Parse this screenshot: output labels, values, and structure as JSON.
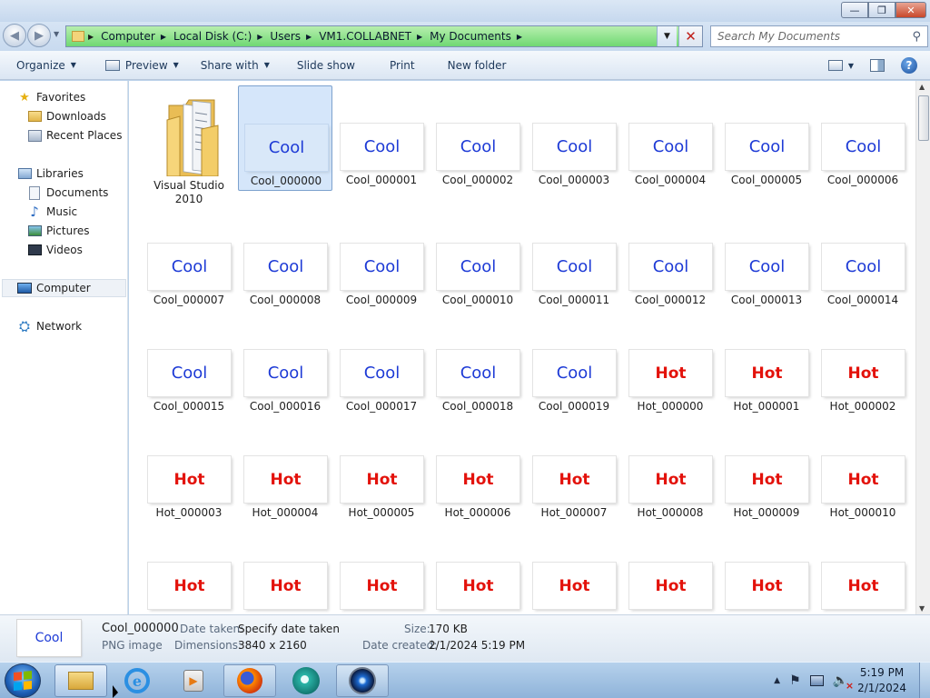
{
  "window": {
    "controls": {
      "minimize": "—",
      "maximize": "❐",
      "close": "✕"
    }
  },
  "address": {
    "breadcrumbs": [
      "Computer",
      "Local Disk (C:)",
      "Users",
      "VM1.COLLABNET",
      "My Documents"
    ],
    "search_placeholder": "Search My Documents"
  },
  "toolbar": {
    "organize": "Organize",
    "preview": "Preview",
    "share_with": "Share with",
    "slide_show": "Slide show",
    "print": "Print",
    "new_folder": "New folder"
  },
  "nav": {
    "favorites": "Favorites",
    "downloads": "Downloads",
    "recent_places": "Recent Places",
    "libraries": "Libraries",
    "documents": "Documents",
    "music": "Music",
    "pictures": "Pictures",
    "videos": "Videos",
    "computer": "Computer",
    "network": "Network"
  },
  "folder": {
    "label_line1": "Visual Studio",
    "label_line2": "2010"
  },
  "files": [
    {
      "name": "Cool_000000",
      "thumb": "Cool",
      "selected": true
    },
    {
      "name": "Cool_000001",
      "thumb": "Cool"
    },
    {
      "name": "Cool_000002",
      "thumb": "Cool"
    },
    {
      "name": "Cool_000003",
      "thumb": "Cool"
    },
    {
      "name": "Cool_000004",
      "thumb": "Cool"
    },
    {
      "name": "Cool_000005",
      "thumb": "Cool"
    },
    {
      "name": "Cool_000006",
      "thumb": "Cool"
    },
    {
      "name": "Cool_000007",
      "thumb": "Cool"
    },
    {
      "name": "Cool_000008",
      "thumb": "Cool"
    },
    {
      "name": "Cool_000009",
      "thumb": "Cool"
    },
    {
      "name": "Cool_000010",
      "thumb": "Cool"
    },
    {
      "name": "Cool_000011",
      "thumb": "Cool"
    },
    {
      "name": "Cool_000012",
      "thumb": "Cool"
    },
    {
      "name": "Cool_000013",
      "thumb": "Cool"
    },
    {
      "name": "Cool_000014",
      "thumb": "Cool"
    },
    {
      "name": "Cool_000015",
      "thumb": "Cool"
    },
    {
      "name": "Cool_000016",
      "thumb": "Cool"
    },
    {
      "name": "Cool_000017",
      "thumb": "Cool"
    },
    {
      "name": "Cool_000018",
      "thumb": "Cool"
    },
    {
      "name": "Cool_000019",
      "thumb": "Cool"
    },
    {
      "name": "Hot_000000",
      "thumb": "Hot"
    },
    {
      "name": "Hot_000001",
      "thumb": "Hot"
    },
    {
      "name": "Hot_000002",
      "thumb": "Hot"
    },
    {
      "name": "Hot_000003",
      "thumb": "Hot"
    },
    {
      "name": "Hot_000004",
      "thumb": "Hot"
    },
    {
      "name": "Hot_000005",
      "thumb": "Hot"
    },
    {
      "name": "Hot_000006",
      "thumb": "Hot"
    },
    {
      "name": "Hot_000007",
      "thumb": "Hot"
    },
    {
      "name": "Hot_000008",
      "thumb": "Hot"
    },
    {
      "name": "Hot_000009",
      "thumb": "Hot"
    },
    {
      "name": "Hot_000010",
      "thumb": "Hot"
    },
    {
      "name": "",
      "thumb": "Hot"
    },
    {
      "name": "",
      "thumb": "Hot"
    },
    {
      "name": "",
      "thumb": "Hot"
    },
    {
      "name": "",
      "thumb": "Hot"
    },
    {
      "name": "",
      "thumb": "Hot"
    },
    {
      "name": "",
      "thumb": "Hot"
    },
    {
      "name": "",
      "thumb": "Hot"
    },
    {
      "name": "",
      "thumb": "Hot"
    }
  ],
  "details": {
    "thumb": "Cool",
    "filename": "Cool_000000",
    "filetype": "PNG image",
    "date_taken_label": "Date taken:",
    "date_taken_value": "Specify date taken",
    "dimensions_label": "Dimensions:",
    "dimensions_value": "3840 x 2160",
    "size_label": "Size:",
    "size_value": "170 KB",
    "date_created_label": "Date created:",
    "date_created_value": "2/1/2024 5:19 PM"
  },
  "taskbar": {
    "time": "5:19 PM",
    "date": "2/1/2024"
  },
  "colors": {
    "cool_text": "#1e3bd6",
    "hot_text": "#e3120b",
    "address_bar": "#6fd873",
    "selection": "#d5e6fa"
  }
}
